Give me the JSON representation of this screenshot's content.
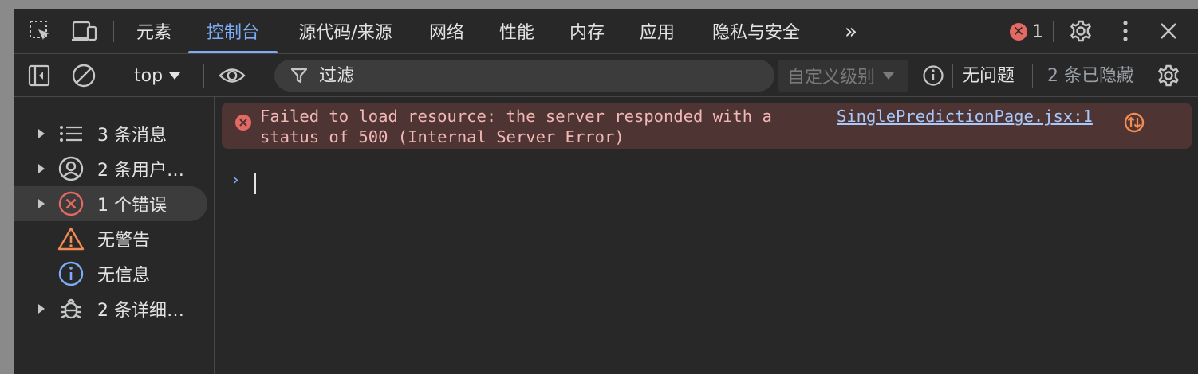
{
  "tabbar": {
    "tabs": [
      {
        "label": "元素"
      },
      {
        "label": "控制台"
      },
      {
        "label": "源代码/来源"
      },
      {
        "label": "网络"
      },
      {
        "label": "性能"
      },
      {
        "label": "内存"
      },
      {
        "label": "应用"
      },
      {
        "label": "隐私与安全"
      }
    ],
    "active_tab": "控制台",
    "more_tabs": "»",
    "error_count": "1"
  },
  "toolbar": {
    "context": "top",
    "filter_placeholder": "过滤",
    "levels_label": "自定义级别",
    "issues_text": "无问题",
    "hidden_text": "2 条已隐藏"
  },
  "sidebar": {
    "items": [
      {
        "label": "3 条消息",
        "icon": "list-icon",
        "expandable": true
      },
      {
        "label": "2 条用户…",
        "icon": "user-icon",
        "expandable": true
      },
      {
        "label": "1 个错误",
        "icon": "error-icon",
        "expandable": true,
        "selected": true
      },
      {
        "label": "无警告",
        "icon": "warning-icon",
        "expandable": false
      },
      {
        "label": "无信息",
        "icon": "info-icon",
        "expandable": false
      },
      {
        "label": "2 条详细…",
        "icon": "bug-icon",
        "expandable": true
      }
    ]
  },
  "console": {
    "error": {
      "text": "Failed to load resource: the server responded with a status of 500 (Internal Server Error)",
      "source": "SinglePredictionPage.jsx:1"
    },
    "prompt": "›"
  },
  "colors": {
    "background": "#282828",
    "accent": "#7cacf8",
    "error": "#e46962",
    "error_bg": "#4e3534",
    "error_text": "#f2b8b5",
    "warning": "#f28b54",
    "info": "#7cacf8"
  }
}
